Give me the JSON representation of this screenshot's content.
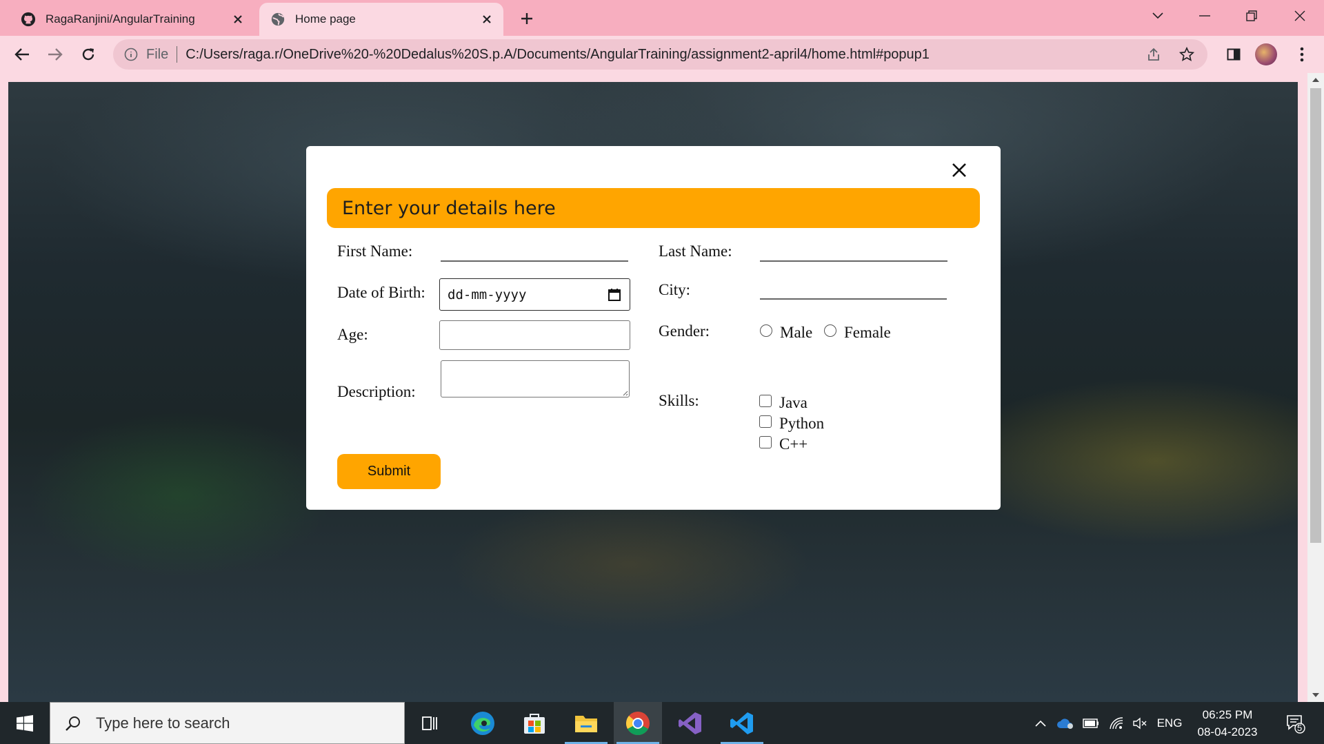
{
  "browser": {
    "tabs": [
      {
        "title": "RagaRanjini/AngularTraining",
        "favicon": "github-icon",
        "active": false
      },
      {
        "title": "Home page",
        "favicon": "globe-icon",
        "active": true
      }
    ],
    "omnibox": {
      "scheme_label": "File",
      "url": "C:/Users/raga.r/OneDrive%20-%20Dedalus%20S.p.A/Documents/AngularTraining/assignment2-april4/home.html#popup1"
    }
  },
  "popup": {
    "header": "Enter your details here",
    "fields": {
      "first_name_label": "First Name:",
      "last_name_label": "Last Name:",
      "dob_label": "Date of Birth:",
      "dob_placeholder": "dd-mm-yyyy",
      "city_label": "City:",
      "age_label": "Age:",
      "gender_label": "Gender:",
      "description_label": "Description:",
      "skills_label": "Skills:"
    },
    "gender_options": [
      "Male",
      "Female"
    ],
    "skills_options": [
      "Java",
      "Python",
      "C++"
    ],
    "submit_label": "Submit"
  },
  "taskbar": {
    "search_placeholder": "Type here to search",
    "language": "ENG",
    "time": "06:25 PM",
    "date": "08-04-2023",
    "notification_count": "5"
  },
  "colors": {
    "chrome_frame": "#f7aebf",
    "chrome_toolbar": "#fbd9e2",
    "accent": "#ffa500",
    "taskbar": "#20272b"
  }
}
